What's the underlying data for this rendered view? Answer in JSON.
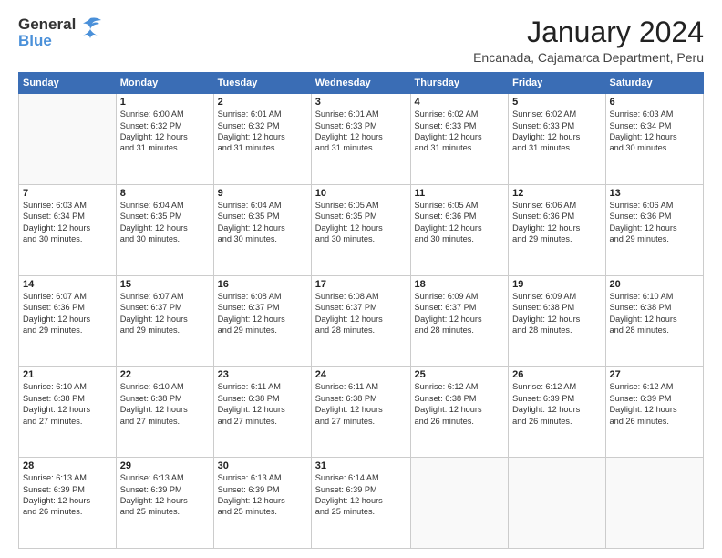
{
  "header": {
    "logo_general": "General",
    "logo_blue": "Blue",
    "month_title": "January 2024",
    "location": "Encanada, Cajamarca Department, Peru"
  },
  "days_of_week": [
    "Sunday",
    "Monday",
    "Tuesday",
    "Wednesday",
    "Thursday",
    "Friday",
    "Saturday"
  ],
  "weeks": [
    [
      {
        "day": "",
        "info": ""
      },
      {
        "day": "1",
        "info": "Sunrise: 6:00 AM\nSunset: 6:32 PM\nDaylight: 12 hours\nand 31 minutes."
      },
      {
        "day": "2",
        "info": "Sunrise: 6:01 AM\nSunset: 6:32 PM\nDaylight: 12 hours\nand 31 minutes."
      },
      {
        "day": "3",
        "info": "Sunrise: 6:01 AM\nSunset: 6:33 PM\nDaylight: 12 hours\nand 31 minutes."
      },
      {
        "day": "4",
        "info": "Sunrise: 6:02 AM\nSunset: 6:33 PM\nDaylight: 12 hours\nand 31 minutes."
      },
      {
        "day": "5",
        "info": "Sunrise: 6:02 AM\nSunset: 6:33 PM\nDaylight: 12 hours\nand 31 minutes."
      },
      {
        "day": "6",
        "info": "Sunrise: 6:03 AM\nSunset: 6:34 PM\nDaylight: 12 hours\nand 30 minutes."
      }
    ],
    [
      {
        "day": "7",
        "info": "Sunrise: 6:03 AM\nSunset: 6:34 PM\nDaylight: 12 hours\nand 30 minutes."
      },
      {
        "day": "8",
        "info": "Sunrise: 6:04 AM\nSunset: 6:35 PM\nDaylight: 12 hours\nand 30 minutes."
      },
      {
        "day": "9",
        "info": "Sunrise: 6:04 AM\nSunset: 6:35 PM\nDaylight: 12 hours\nand 30 minutes."
      },
      {
        "day": "10",
        "info": "Sunrise: 6:05 AM\nSunset: 6:35 PM\nDaylight: 12 hours\nand 30 minutes."
      },
      {
        "day": "11",
        "info": "Sunrise: 6:05 AM\nSunset: 6:36 PM\nDaylight: 12 hours\nand 30 minutes."
      },
      {
        "day": "12",
        "info": "Sunrise: 6:06 AM\nSunset: 6:36 PM\nDaylight: 12 hours\nand 29 minutes."
      },
      {
        "day": "13",
        "info": "Sunrise: 6:06 AM\nSunset: 6:36 PM\nDaylight: 12 hours\nand 29 minutes."
      }
    ],
    [
      {
        "day": "14",
        "info": "Sunrise: 6:07 AM\nSunset: 6:36 PM\nDaylight: 12 hours\nand 29 minutes."
      },
      {
        "day": "15",
        "info": "Sunrise: 6:07 AM\nSunset: 6:37 PM\nDaylight: 12 hours\nand 29 minutes."
      },
      {
        "day": "16",
        "info": "Sunrise: 6:08 AM\nSunset: 6:37 PM\nDaylight: 12 hours\nand 29 minutes."
      },
      {
        "day": "17",
        "info": "Sunrise: 6:08 AM\nSunset: 6:37 PM\nDaylight: 12 hours\nand 28 minutes."
      },
      {
        "day": "18",
        "info": "Sunrise: 6:09 AM\nSunset: 6:37 PM\nDaylight: 12 hours\nand 28 minutes."
      },
      {
        "day": "19",
        "info": "Sunrise: 6:09 AM\nSunset: 6:38 PM\nDaylight: 12 hours\nand 28 minutes."
      },
      {
        "day": "20",
        "info": "Sunrise: 6:10 AM\nSunset: 6:38 PM\nDaylight: 12 hours\nand 28 minutes."
      }
    ],
    [
      {
        "day": "21",
        "info": "Sunrise: 6:10 AM\nSunset: 6:38 PM\nDaylight: 12 hours\nand 27 minutes."
      },
      {
        "day": "22",
        "info": "Sunrise: 6:10 AM\nSunset: 6:38 PM\nDaylight: 12 hours\nand 27 minutes."
      },
      {
        "day": "23",
        "info": "Sunrise: 6:11 AM\nSunset: 6:38 PM\nDaylight: 12 hours\nand 27 minutes."
      },
      {
        "day": "24",
        "info": "Sunrise: 6:11 AM\nSunset: 6:38 PM\nDaylight: 12 hours\nand 27 minutes."
      },
      {
        "day": "25",
        "info": "Sunrise: 6:12 AM\nSunset: 6:38 PM\nDaylight: 12 hours\nand 26 minutes."
      },
      {
        "day": "26",
        "info": "Sunrise: 6:12 AM\nSunset: 6:39 PM\nDaylight: 12 hours\nand 26 minutes."
      },
      {
        "day": "27",
        "info": "Sunrise: 6:12 AM\nSunset: 6:39 PM\nDaylight: 12 hours\nand 26 minutes."
      }
    ],
    [
      {
        "day": "28",
        "info": "Sunrise: 6:13 AM\nSunset: 6:39 PM\nDaylight: 12 hours\nand 26 minutes."
      },
      {
        "day": "29",
        "info": "Sunrise: 6:13 AM\nSunset: 6:39 PM\nDaylight: 12 hours\nand 25 minutes."
      },
      {
        "day": "30",
        "info": "Sunrise: 6:13 AM\nSunset: 6:39 PM\nDaylight: 12 hours\nand 25 minutes."
      },
      {
        "day": "31",
        "info": "Sunrise: 6:14 AM\nSunset: 6:39 PM\nDaylight: 12 hours\nand 25 minutes."
      },
      {
        "day": "",
        "info": ""
      },
      {
        "day": "",
        "info": ""
      },
      {
        "day": "",
        "info": ""
      }
    ]
  ]
}
